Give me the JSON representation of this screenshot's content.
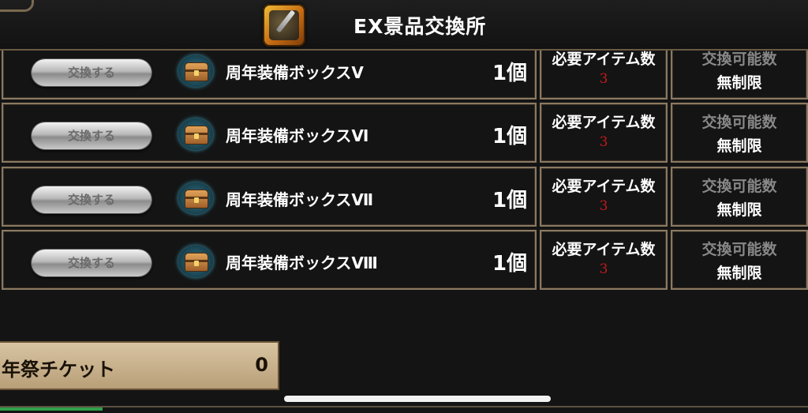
{
  "header": {
    "title": "EX景品交換所",
    "icon": "ex-shop-icon"
  },
  "rows": [
    {
      "button_label": "交換する",
      "item_name": "周年装備ボックスⅤ",
      "quantity": "1個",
      "required_label": "必要アイテム数",
      "required_value": "3",
      "limit_label": "交換可能数",
      "limit_value": "無制限",
      "icon": "treasure-chest-icon"
    },
    {
      "button_label": "交換する",
      "item_name": "周年装備ボックスⅥ",
      "quantity": "1個",
      "required_label": "必要アイテム数",
      "required_value": "3",
      "limit_label": "交換可能数",
      "limit_value": "無制限",
      "icon": "treasure-chest-icon"
    },
    {
      "button_label": "交換する",
      "item_name": "周年装備ボックスⅦ",
      "quantity": "1個",
      "required_label": "必要アイテム数",
      "required_value": "3",
      "limit_label": "交換可能数",
      "limit_value": "無制限",
      "icon": "treasure-chest-icon"
    },
    {
      "button_label": "交換する",
      "item_name": "周年装備ボックスⅧ",
      "quantity": "1個",
      "required_label": "必要アイテム数",
      "required_value": "3",
      "limit_label": "交換可能数",
      "limit_value": "無制限",
      "icon": "treasure-chest-icon"
    }
  ],
  "ticket": {
    "label": "年祭チケット",
    "count": "0"
  },
  "colors": {
    "required_value": "#c11a1a",
    "frame": "#8a7a62",
    "limit_label": "#888888"
  }
}
